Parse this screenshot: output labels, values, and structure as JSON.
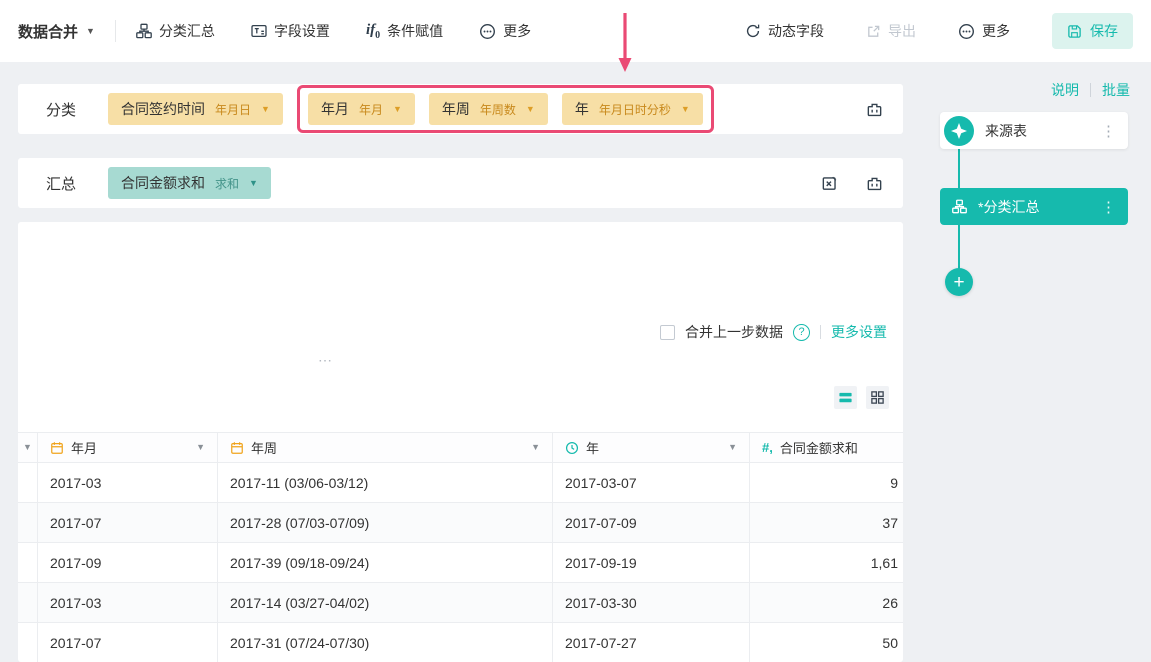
{
  "colors": {
    "accent_teal": "#16baad",
    "highlight_red": "#ea4a74",
    "tag_yellow_bg": "#f7dfa6",
    "tag_yellow_accent": "#dd9e27",
    "tag_teal_bg": "#a7dad2",
    "calendar_icon_orange": "#f0a41d"
  },
  "icons": {
    "caret_down": "▼",
    "kebab": "⋮",
    "plus": "+",
    "question": "?",
    "ellipsis": "⋯",
    "if_main": "if",
    "if_sub": "0",
    "number_sign": "#,"
  },
  "toolbar": {
    "menu_label": "数据合并",
    "items": [
      {
        "label": "分类汇总"
      },
      {
        "label": "字段设置"
      },
      {
        "label": "条件赋值"
      },
      {
        "label": "更多"
      }
    ],
    "right": {
      "dynamic_field": "动态字段",
      "export": "导出",
      "more": "更多",
      "save": "保存"
    }
  },
  "config": {
    "category": {
      "label": "分类",
      "tags": [
        {
          "name": "合同签约时间",
          "type": "年月日"
        },
        {
          "name": "年月",
          "type": "年月"
        },
        {
          "name": "年周",
          "type": "年周数"
        },
        {
          "name": "年",
          "type": "年月日时分秒"
        }
      ]
    },
    "summary": {
      "label": "汇总",
      "tags": [
        {
          "name": "合同金额求和",
          "type": "求和"
        }
      ]
    },
    "merge_option_label": "合并上一步数据",
    "more_settings_label": "更多设置"
  },
  "table": {
    "columns": [
      {
        "label": ""
      },
      {
        "label": "年月"
      },
      {
        "label": "年周"
      },
      {
        "label": "年"
      },
      {
        "label": "合同金额求和"
      }
    ],
    "rows": [
      [
        "2017-03",
        "2017-11 (03/06-03/12)",
        "2017-03-07",
        "9"
      ],
      [
        "2017-07",
        "2017-28 (07/03-07/09)",
        "2017-07-09",
        "37"
      ],
      [
        "2017-09",
        "2017-39 (09/18-09/24)",
        "2017-09-19",
        "1,61"
      ],
      [
        "2017-03",
        "2017-14 (03/27-04/02)",
        "2017-03-30",
        "26"
      ],
      [
        "2017-07",
        "2017-31 (07/24-07/30)",
        "2017-07-27",
        "50"
      ]
    ]
  },
  "sidebar": {
    "links": [
      {
        "label": "说明"
      },
      {
        "label": "批量"
      }
    ],
    "nodes": [
      {
        "label": "来源表"
      },
      {
        "label": "*分类汇总"
      }
    ]
  }
}
